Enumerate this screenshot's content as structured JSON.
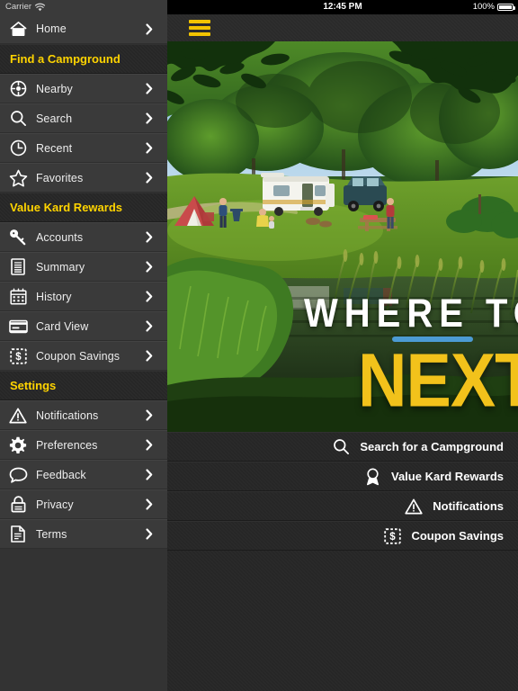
{
  "statusbar": {
    "carrier": "Carrier",
    "wifi_icon": "wifi-icon",
    "time": "12:45 PM",
    "battery_percent": "100%",
    "battery_icon": "battery-full-icon"
  },
  "navbar": {
    "menu_icon": "hamburger-menu-icon"
  },
  "sidebar": {
    "groups": [
      {
        "header": null,
        "items": [
          {
            "label": "Home",
            "icon": "home-icon"
          }
        ]
      },
      {
        "header": "Find a Campground",
        "items": [
          {
            "label": "Nearby",
            "icon": "compass-icon"
          },
          {
            "label": "Search",
            "icon": "magnifier-icon"
          },
          {
            "label": "Recent",
            "icon": "clock-icon"
          },
          {
            "label": "Favorites",
            "icon": "star-icon"
          }
        ]
      },
      {
        "header": "Value Kard Rewards",
        "items": [
          {
            "label": "Accounts",
            "icon": "key-icon"
          },
          {
            "label": "Summary",
            "icon": "document-lines-icon"
          },
          {
            "label": "History",
            "icon": "calendar-icon"
          },
          {
            "label": "Card View",
            "icon": "credit-card-icon"
          },
          {
            "label": "Coupon Savings",
            "icon": "coupon-dollar-icon"
          }
        ]
      },
      {
        "header": "Settings",
        "items": [
          {
            "label": "Notifications",
            "icon": "warning-triangle-icon"
          },
          {
            "label": "Preferences",
            "icon": "gear-icon"
          },
          {
            "label": "Feedback",
            "icon": "speech-bubble-icon"
          },
          {
            "label": "Privacy",
            "icon": "lock-icon"
          },
          {
            "label": "Terms",
            "icon": "document-icon"
          }
        ]
      }
    ],
    "chevron_icon": "chevron-right-icon"
  },
  "hero": {
    "headline_top": "WHERE TO",
    "headline_bottom": "NEXT?",
    "accent_color": "#4C9BD4",
    "headline_bottom_color": "#F2C21B",
    "scene": "campground-photo-rv-tent-pond"
  },
  "quick_menu": {
    "items": [
      {
        "label": "Search for a Campground",
        "icon": "magnifier-icon"
      },
      {
        "label": "Value Kard Rewards",
        "icon": "award-ribbon-icon"
      },
      {
        "label": "Notifications",
        "icon": "warning-triangle-icon"
      },
      {
        "label": "Coupon Savings",
        "icon": "coupon-dollar-icon"
      }
    ]
  },
  "colors": {
    "section_header_text": "#FFD400",
    "sidebar_bg": "#3a3a3a",
    "accent_yellow": "#F2C400"
  }
}
